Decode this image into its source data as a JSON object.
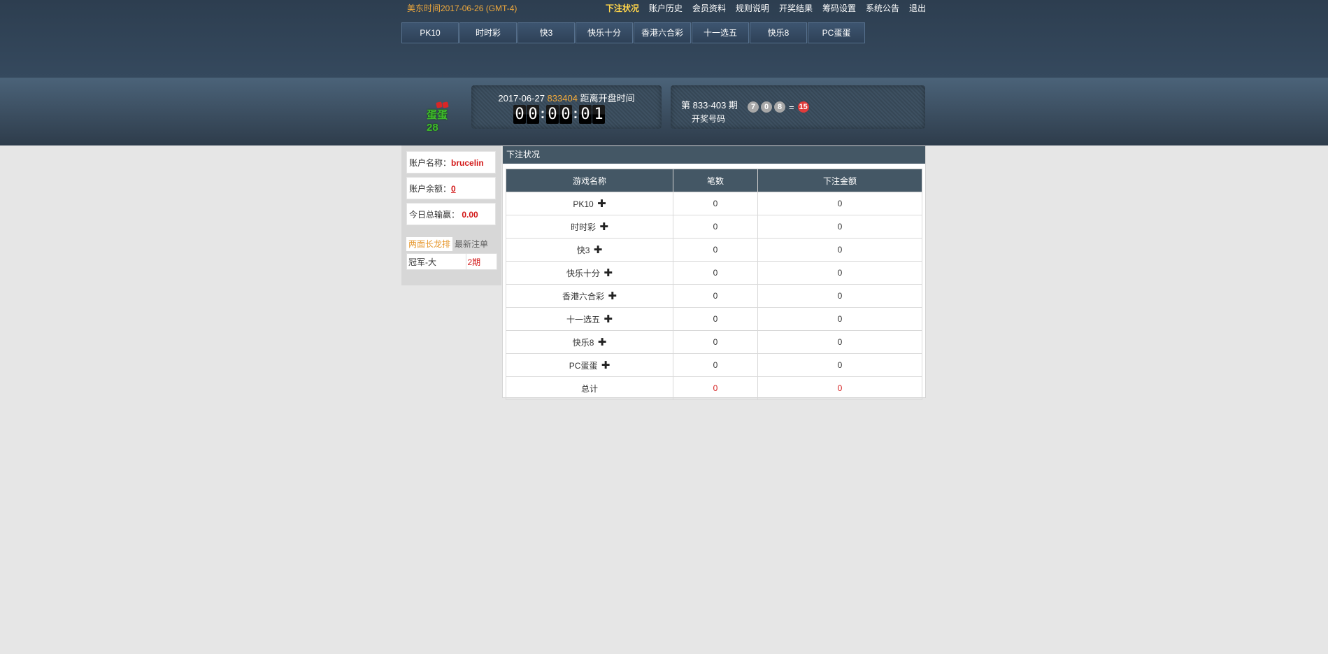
{
  "header": {
    "time_label": "美东时间2017-06-26 (GMT-4)",
    "nav": [
      "下注状况",
      "账户历史",
      "会员资料",
      "规则说明",
      "开奖结果",
      "筹码设置",
      "系统公告",
      "退出"
    ],
    "active_nav": "下注状况",
    "game_tabs": [
      "PK10",
      "时时彩",
      "快3",
      "快乐十分",
      "香港六合彩",
      "十一选五",
      "快乐8",
      "PC蛋蛋"
    ]
  },
  "banner": {
    "logo_text": "蛋蛋28",
    "date": "2017-06-27",
    "issue": "833404",
    "countdown_label": "距离开盘时间",
    "countdown": [
      "0",
      "0",
      ":",
      "0",
      "0",
      ":",
      "0",
      "1"
    ],
    "result_issue": "第 833-403 期",
    "result_label": "开奖号码",
    "balls": [
      "7",
      "0",
      "8"
    ],
    "equals": "=",
    "sum": "15"
  },
  "sidebar": {
    "account_name_label": "账户名称：",
    "account_name": "brucelin",
    "balance_label": "账户余额：",
    "balance": "0",
    "profit_label": "今日总输赢：",
    "profit": "0.00",
    "tabs": [
      "两面长龙排",
      "最新注单"
    ],
    "dragon_rows": [
      {
        "name": "冠军-大",
        "periods": "2期"
      }
    ]
  },
  "main": {
    "panel_title": "下注状况",
    "columns": [
      "游戏名称",
      "笔数",
      "下注金额"
    ],
    "rows": [
      {
        "name": "PK10",
        "count": "0",
        "amount": "0"
      },
      {
        "name": "时时彩",
        "count": "0",
        "amount": "0"
      },
      {
        "name": "快3",
        "count": "0",
        "amount": "0"
      },
      {
        "name": "快乐十分",
        "count": "0",
        "amount": "0"
      },
      {
        "name": "香港六合彩",
        "count": "0",
        "amount": "0"
      },
      {
        "name": "十一选五",
        "count": "0",
        "amount": "0"
      },
      {
        "name": "快乐8",
        "count": "0",
        "amount": "0"
      },
      {
        "name": "PC蛋蛋",
        "count": "0",
        "amount": "0"
      }
    ],
    "total": {
      "name": "总计",
      "count": "0",
      "amount": "0"
    },
    "plus_symbol": "✚"
  },
  "colors": {
    "header_bg": "#2d3e50",
    "accent_orange": "#f0a93c",
    "active_nav": "#ffd54a",
    "table_head": "#445765",
    "highlight_red": "#d31a1a",
    "page_bg": "#e6e6e6"
  }
}
